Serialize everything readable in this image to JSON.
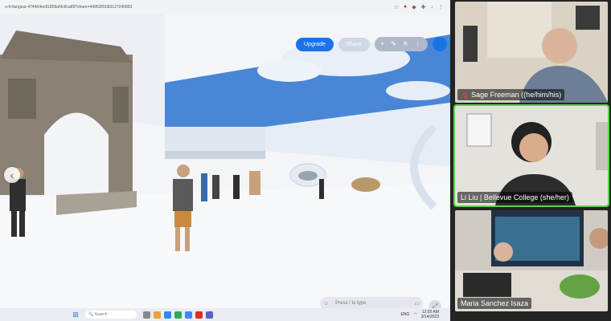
{
  "browser": {
    "url": "o-fi-hangout-474464ec81859a5fc8ca89?share=4496355683127240803",
    "icons": [
      "bookmark-icon",
      "record-icon",
      "extension-icon",
      "puzzle-icon",
      "download-icon",
      "menu-icon"
    ]
  },
  "app": {
    "upgrade_label": "Upgrade",
    "share_label": "Share",
    "tools": [
      "+",
      "✎",
      "✕",
      "⋮"
    ],
    "chat_placeholder": "Press / to type",
    "accent": "#1a73e8"
  },
  "taskbar": {
    "search_label": "Search",
    "lang": "ENG",
    "time": "12:05 AM",
    "date": "3/14/2023"
  },
  "participants": [
    {
      "name": "Sage Freeman ((he/him/his)",
      "muted": true,
      "active": false
    },
    {
      "name": "Li Liu | Bellevue College (she/her)",
      "muted": false,
      "active": true
    },
    {
      "name": "Maria Sanchez Isaza",
      "muted": false,
      "active": false
    }
  ],
  "colors": {
    "active_speaker": "#5bd44c",
    "mute": "#e0483e"
  }
}
